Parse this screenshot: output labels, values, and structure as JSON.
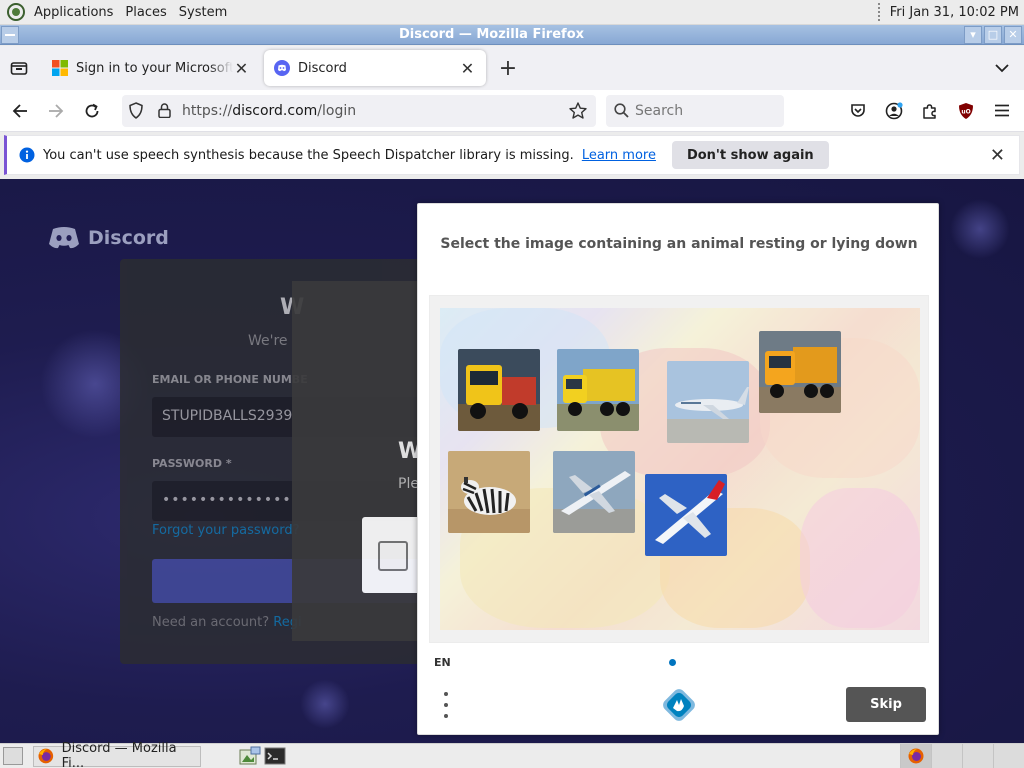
{
  "top_panel": {
    "menus": [
      "Applications",
      "Places",
      "System"
    ],
    "clock": "Fri Jan 31, 10:02 PM"
  },
  "window": {
    "title": "Discord — Mozilla Firefox"
  },
  "tabs": [
    {
      "label": "Sign in to your Microsoft acc",
      "favicon": "microsoft-icon",
      "active": false
    },
    {
      "label": "Discord",
      "favicon": "discord-icon",
      "active": true
    }
  ],
  "navbar": {
    "url_prefix": "https://",
    "url_host": "discord.com",
    "url_path": "/login",
    "search_placeholder": "Search"
  },
  "notification": {
    "text": "You can't use speech synthesis because the Speech Dispatcher library is missing.",
    "link": "Learn more",
    "button": "Don't show again"
  },
  "discord_page": {
    "brand": "Discord",
    "heading": "W",
    "subtitle": "We're",
    "email_label": "EMAIL OR PHONE NUMBE",
    "email_value": "STUPIDBALLS2939",
    "password_label": "PASSWORD *",
    "password_value": "••••••••••••••",
    "forgot": "Forgot your password?",
    "register_prefix": "Need an account?",
    "register_link": "Regi",
    "overlay_heading": "W",
    "overlay_sub": "Ple"
  },
  "captcha": {
    "prompt": "Select the image containing an animal resting or lying down",
    "language": "EN",
    "skip_label": "Skip",
    "tiles": [
      {
        "name": "truck-tile-1",
        "subject": "truck"
      },
      {
        "name": "truck-tile-2",
        "subject": "truck"
      },
      {
        "name": "airplane-tile-1",
        "subject": "airplane"
      },
      {
        "name": "truck-tile-3",
        "subject": "truck"
      },
      {
        "name": "zebra-tile",
        "subject": "zebra lying down"
      },
      {
        "name": "airplane-tile-2",
        "subject": "airplane"
      },
      {
        "name": "airplane-tile-3",
        "subject": "airplane"
      }
    ]
  },
  "taskbar": {
    "task_label": "Discord — Mozilla Fi..."
  },
  "colors": {
    "accent": "#7a54d4",
    "link": "#0061e0",
    "titlebar": "#88a8d4",
    "discord_bg": "#1e1c4f",
    "skip_button": "#555555"
  }
}
